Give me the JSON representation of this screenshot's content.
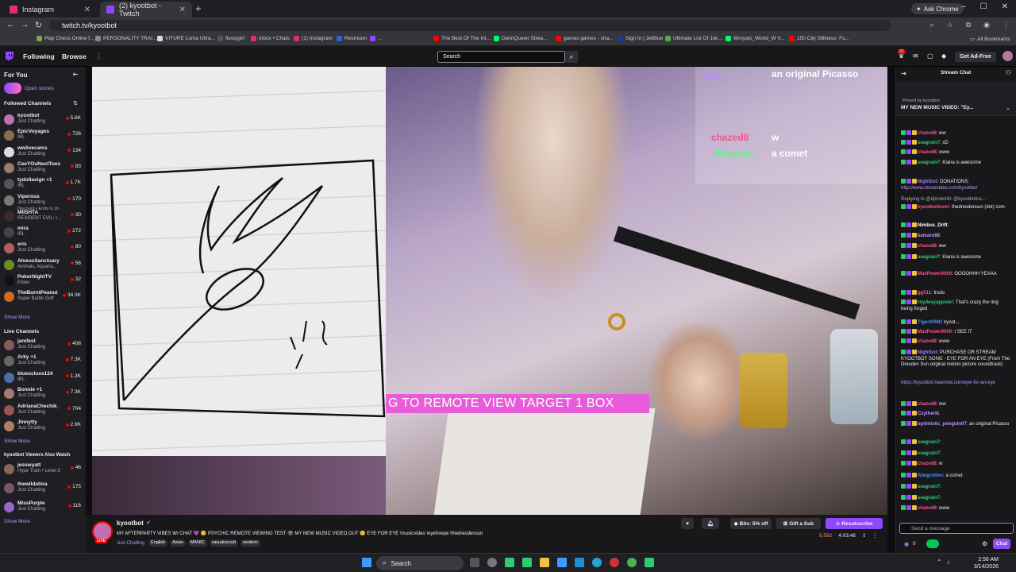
{
  "browser": {
    "tabs": [
      {
        "title": "Instagram",
        "color": "#e1306c"
      },
      {
        "title": "(2) kyootbot - Twitch",
        "color": "#9147ff"
      }
    ],
    "ask_chrome": "Ask Chrome",
    "url": "twitch.tv/kyootbot",
    "bookmarks": [
      {
        "label": "Play Chess Online f...",
        "color": "#7fa650"
      },
      {
        "label": "PERSONALITY TRAI...",
        "color": "#888888"
      },
      {
        "label": "VITURE Luma Ultra...",
        "color": "#dddddd"
      },
      {
        "label": "fiestygirl",
        "color": "#555555"
      },
      {
        "label": "Inbox • Chats",
        "color": "#e1306c"
      },
      {
        "label": "(1) Instagram",
        "color": "#e1306c"
      },
      {
        "label": "Restream",
        "color": "#2563eb"
      },
      {
        "label": "...",
        "color": "#9147ff"
      },
      {
        "label": "The Best Of The Int...",
        "color": "#ff0000"
      },
      {
        "label": "DeimQueen Strea...",
        "color": "#00ff66"
      },
      {
        "label": "games games - sha...",
        "color": "#ff0000"
      },
      {
        "label": "Sign In | JetBlue",
        "color": "#1e3a8a"
      },
      {
        "label": "Ultimate List Of Jok...",
        "color": "#4caf50"
      },
      {
        "label": "Wroyals_World_W V...",
        "color": "#00ff66"
      },
      {
        "label": "150 City Silliness: Fu...",
        "color": "#ff0000"
      }
    ],
    "all_bookmarks": "All Bookmarks"
  },
  "twitch_nav": {
    "following": "Following",
    "browse": "Browse",
    "search_placeholder": "Search",
    "notif_count": "31",
    "get_ad_free": "Get Ad-Free"
  },
  "sidebar": {
    "for_you": "For You",
    "open_stories": "Open stories",
    "followed_header": "Followed Channels",
    "followed": [
      {
        "name": "kyootbot",
        "game": "Just Chatting",
        "viewers": "5.6K",
        "color": "#c06fb0"
      },
      {
        "name": "EpicVoyages",
        "game": "IRL",
        "viewers": "726",
        "color": "#8a6e4e"
      },
      {
        "name": "wwlivecams",
        "game": "Just Chatting",
        "viewers": "134",
        "color": "#dddddd"
      },
      {
        "name": "CeeYOuNextTues",
        "game": "Just Chatting",
        "viewers": "83",
        "color": "#9e7a6a"
      },
      {
        "name": "tydollasign +1",
        "game": "IRL",
        "viewers": "1.7K",
        "color": "#555555"
      },
      {
        "name": "Viperous",
        "game": "Just Chatting",
        "viewers": "170",
        "color": "#7a7a7a"
      },
      {
        "name": "MIISHTA",
        "game": "RESIDENT EVIL: r...",
        "viewers": "30",
        "color": "#3a2a2a"
      },
      {
        "name": "mira",
        "game": "IRL",
        "viewers": "272",
        "color": "#444444"
      },
      {
        "name": "eris",
        "game": "Just Chatting",
        "viewers": "90",
        "color": "#b06060"
      },
      {
        "name": "AlveusSanctuary",
        "game": "Animals, Aquariu...",
        "viewers": "56",
        "color": "#6b8e23"
      },
      {
        "name": "PokerNightTV",
        "game": "Poker",
        "viewers": "32",
        "color": "#111111"
      },
      {
        "name": "TheBurntPeanut",
        "game": "Super Battle Golf",
        "viewers": "34.3K",
        "color": "#d2691e"
      }
    ],
    "viperous_note": "Discount • Ends in 1h",
    "show_more_1": "Show More",
    "live_header": "Live Channels",
    "live": [
      {
        "name": "janifest",
        "game": "Just Chatting",
        "viewers": "408",
        "color": "#8b5a5a"
      },
      {
        "name": "Arky +1",
        "game": "Just Chatting",
        "viewers": "7.3K",
        "color": "#666666"
      },
      {
        "name": "bluesclues124",
        "game": "IRL",
        "viewers": "1.3K",
        "color": "#4a6fa5"
      },
      {
        "name": "Bonnie +1",
        "game": "Just Chatting",
        "viewers": "7.3K",
        "color": "#aa7777"
      },
      {
        "name": "AdrianaChechik_",
        "game": "Just Chatting",
        "viewers": "704",
        "color": "#995555"
      },
      {
        "name": "Jinnytty",
        "game": "Just Chatting",
        "viewers": "2.9K",
        "color": "#b08060"
      }
    ],
    "show_more_2": "Show More",
    "also_header": "kyootbot Viewers Also Watch",
    "also": [
      {
        "name": "jesswyatt",
        "game": "Hype Train • Level 3",
        "viewers": "46",
        "color": "#886655"
      },
      {
        "name": "thewildatina",
        "game": "Just Chatting",
        "viewers": "175",
        "color": "#775566"
      },
      {
        "name": "MissPurple",
        "game": "Just Chatting",
        "viewers": "116",
        "color": "#9966cc"
      }
    ],
    "show_more_3": "Show More"
  },
  "video": {
    "overlay_text": "G TO REMOTE VIEW TARGET 1 BOX",
    "alert_top": "an original Picasso",
    "alert_user_partial": "opti...",
    "alert_2_user": "chazed8",
    "alert_2_text": "w",
    "alert_3_user": "Abegrot...",
    "alert_3_text": "a comet"
  },
  "stream_info": {
    "channel": "kyootbot",
    "live": "LIVE",
    "title": "MY AFTERPARTY VIBES W/ CHAT 💜 😊 PSYCHIC REMOTE VIEWING TEST 👁 MY NEW MUSIC VIDEO OUT 😊 EYE FOR EYE !musicvideo !eyeforeye !thedresdensun",
    "category": "Just Chatting",
    "tags": [
      "English",
      "Asian",
      "MANIC",
      "casualoccult",
      "esoteric"
    ],
    "bits": "Bits: 5% off",
    "gift": "Gift a Sub",
    "resub": "Resubscribe",
    "viewers": "5,592",
    "uptime": "4:03:46"
  },
  "chat": {
    "header": "Stream Chat",
    "pinned_by": "Pinned by kyootbot",
    "pinned_text": "MY NEW MUSIC VIDEO: \"Ey...",
    "messages": [
      {
        "user": "chazed8",
        "color": "#ff4f8a",
        "text": "ww"
      },
      {
        "user": "seagrain7",
        "color": "#2ecc71",
        "text": "xD"
      },
      {
        "user": "chazed8",
        "color": "#ff4f8a",
        "text": "www"
      },
      {
        "user": "seagrain7",
        "color": "#2ecc71",
        "text": "Kiana is awesome"
      },
      {
        "user": "Nightbot",
        "color": "#9b7aff",
        "text": "DONATIONS:"
      },
      {
        "user": "",
        "color": "#bf94ff",
        "text": "http://www.streamlabs.com/kyootbot"
      },
      {
        "user": "",
        "color": "#adadb8",
        "text": "Replying to @djmolehill: @kyootbotisc..."
      },
      {
        "user": "kyootbotlover",
        "color": "#ff4f8a",
        "text": "thedresdensun (dot) com"
      },
      {
        "user": "Nimbus_Drift",
        "color": "#ffffff",
        "text": ""
      },
      {
        "user": "kamaro88",
        "color": "#bf94ff",
        "text": ""
      },
      {
        "user": "chazed8",
        "color": "#ff4f8a",
        "text": "ww"
      },
      {
        "user": "seagrain7",
        "color": "#2ecc71",
        "text": "Kiana is awesome"
      },
      {
        "user": "MaxPower9000",
        "color": "#ff4f8a",
        "text": "OOOOHHH YEAAA"
      },
      {
        "user": "gg511",
        "color": "#ff4f8a",
        "text": "frodo"
      },
      {
        "user": "roydesyappster",
        "color": "#2ecc71",
        "text": "That's crazy the ring being forged"
      },
      {
        "user": "TigerAR86",
        "color": "#4a90ff",
        "text": "kyoot...."
      },
      {
        "user": "MaxPower9000",
        "color": "#ff4f8a",
        "text": "I SEE IT"
      },
      {
        "user": "chazed8",
        "color": "#ff4f8a",
        "text": "www"
      },
      {
        "user": "Nightbot",
        "color": "#9b7aff",
        "text": "PURCHASE OR STREAM KYOOTBOT SONG - EYE FOR AN EYE (From The Dresden Sun original motion picture soundtrack)"
      },
      {
        "user": "",
        "color": "#bf94ff",
        "text": "https://kyootbot.hearnow.com/eye-for-an-eye"
      },
      {
        "user": "chazed8",
        "color": "#ff4f8a",
        "text": "ww"
      },
      {
        "user": "Czytherik",
        "color": "#bf94ff",
        "text": ""
      },
      {
        "user": "optimistic_penguin07",
        "color": "#bf94ff",
        "text": "an original Picasso"
      },
      {
        "user": "seagrain7",
        "color": "#2ecc71",
        "text": ""
      },
      {
        "user": "seagrain7",
        "color": "#2ecc71",
        "text": ""
      },
      {
        "user": "chazed8",
        "color": "#ff4f8a",
        "text": "w"
      },
      {
        "user": "Abegrotten",
        "color": "#4a90ff",
        "text": "a comet"
      },
      {
        "user": "seagrain7",
        "color": "#2ecc71",
        "text": ""
      },
      {
        "user": "seagrain7",
        "color": "#2ecc71",
        "text": ""
      },
      {
        "user": "chazed8",
        "color": "#ff4f8a",
        "text": "www"
      }
    ],
    "input_placeholder": "Send a message",
    "points": "0",
    "chat_button": "Chat"
  },
  "taskbar": {
    "search": "Search",
    "time": "2:56 AM",
    "date": "3/14/2026"
  }
}
